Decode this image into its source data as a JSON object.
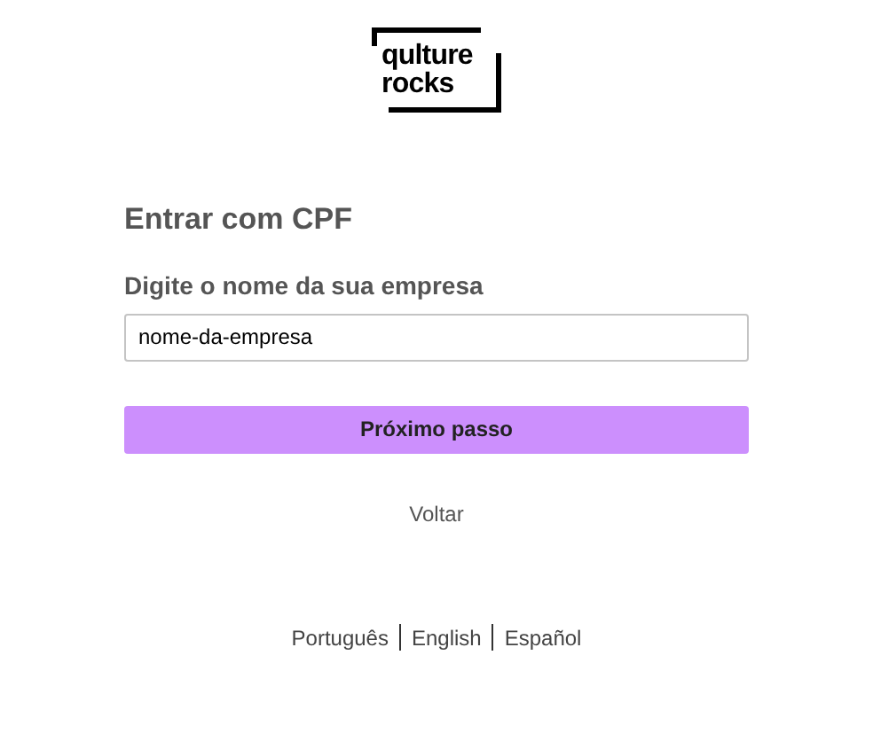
{
  "logo": {
    "line_1": "qulture",
    "line_2": "rocks"
  },
  "title": "Entrar com CPF",
  "company_field": {
    "label": "Digite o nome da sua empresa",
    "value": "nome-da-empresa"
  },
  "next_button": "Próximo passo",
  "back_link": "Voltar",
  "languages": [
    "Português",
    "English",
    "Español"
  ]
}
